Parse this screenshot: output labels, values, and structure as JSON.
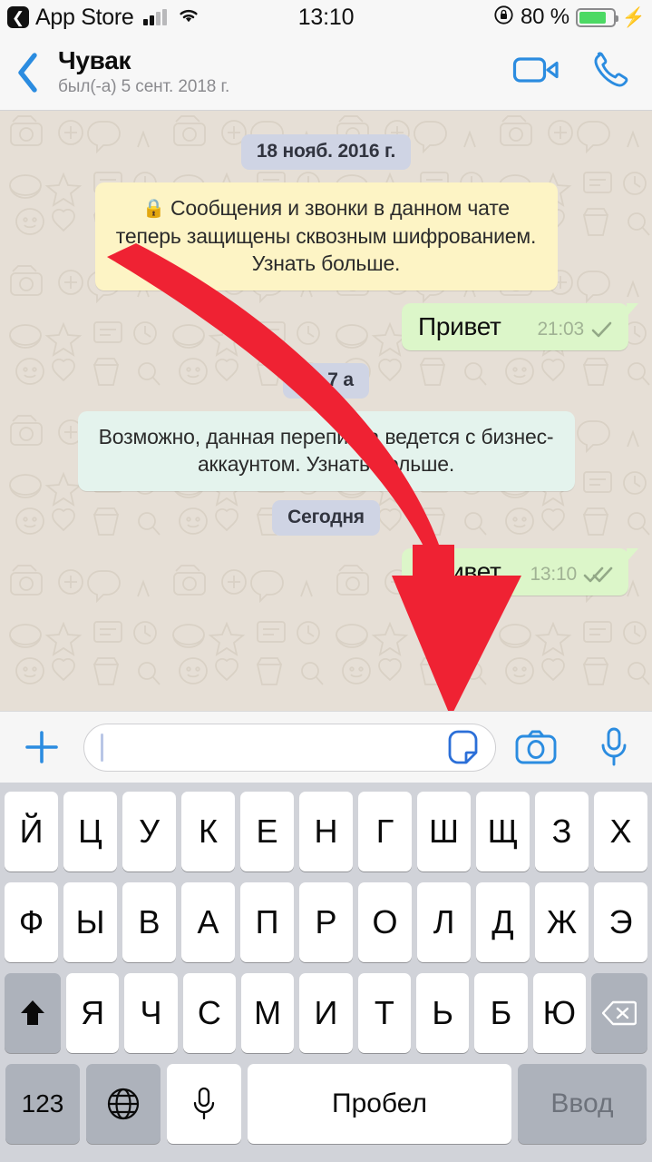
{
  "status_bar": {
    "back_app": "App Store",
    "back_icon": "back-chevron-badge-icon",
    "signal_icon": "cellular-signal-icon",
    "wifi_icon": "wifi-icon",
    "time": "13:10",
    "rotation_lock_icon": "rotation-lock-icon",
    "battery_percent": "80 %",
    "battery_level": 80,
    "charging_icon": "lightning-bolt-icon"
  },
  "chat_header": {
    "back_icon": "back-chevron-icon",
    "contact_name": "Чувак",
    "last_seen": "был(-а) 5 сент. 2018 г.",
    "video_call_icon": "video-camera-icon",
    "voice_call_icon": "phone-handset-icon",
    "accent_color": "#1b87d8"
  },
  "chat": {
    "background_color": "#e6dfd6",
    "items": [
      {
        "kind": "date",
        "text": "18 нояб. 2016 г."
      },
      {
        "kind": "system",
        "variant": "encryption",
        "icon": "lock-icon",
        "text": "Сообщения и звонки в данном чате теперь защищены сквозным шифрованием. Узнать больше.",
        "color": "#fdf4c5"
      },
      {
        "kind": "outgoing",
        "text": "Привет",
        "time": "21:03",
        "ticks": "single-check-icon",
        "color": "#dcf6c9"
      },
      {
        "kind": "date",
        "text": "вт, 7 а"
      },
      {
        "kind": "system",
        "variant": "business",
        "text": "Возможно, данная переписка ведется с бизнес-аккаунтом. Узнать больше.",
        "color": "#e4f3ed"
      },
      {
        "kind": "date",
        "text": "Сегодня"
      },
      {
        "kind": "outgoing",
        "text": "Привет",
        "time": "13:10",
        "ticks": "double-check-icon",
        "color": "#dcf6c9"
      }
    ]
  },
  "annotation": {
    "arrow_color": "#ef2233",
    "arrow_name": "red-pointer-arrow",
    "points_to": "sticker-button"
  },
  "input_bar": {
    "attach_icon": "plus-icon",
    "placeholder": "",
    "value": "",
    "sticker_icon": "sticker-icon",
    "camera_icon": "camera-icon",
    "mic_icon": "microphone-icon",
    "accent_color": "#1b87d8"
  },
  "keyboard": {
    "row1": [
      "Й",
      "Ц",
      "У",
      "К",
      "Е",
      "Н",
      "Г",
      "Ш",
      "Щ",
      "З",
      "Х"
    ],
    "row2": [
      "Ф",
      "Ы",
      "В",
      "А",
      "П",
      "Р",
      "О",
      "Л",
      "Д",
      "Ж",
      "Э"
    ],
    "row3_letters": [
      "Я",
      "Ч",
      "С",
      "М",
      "И",
      "Т",
      "Ь",
      "Б",
      "Ю"
    ],
    "shift_icon": "shift-arrow-icon",
    "backspace_icon": "backspace-icon",
    "numbers_key": "123",
    "globe_icon": "globe-icon",
    "dictation_icon": "microphone-icon",
    "space_key": "Пробел",
    "enter_key": "Ввод"
  }
}
